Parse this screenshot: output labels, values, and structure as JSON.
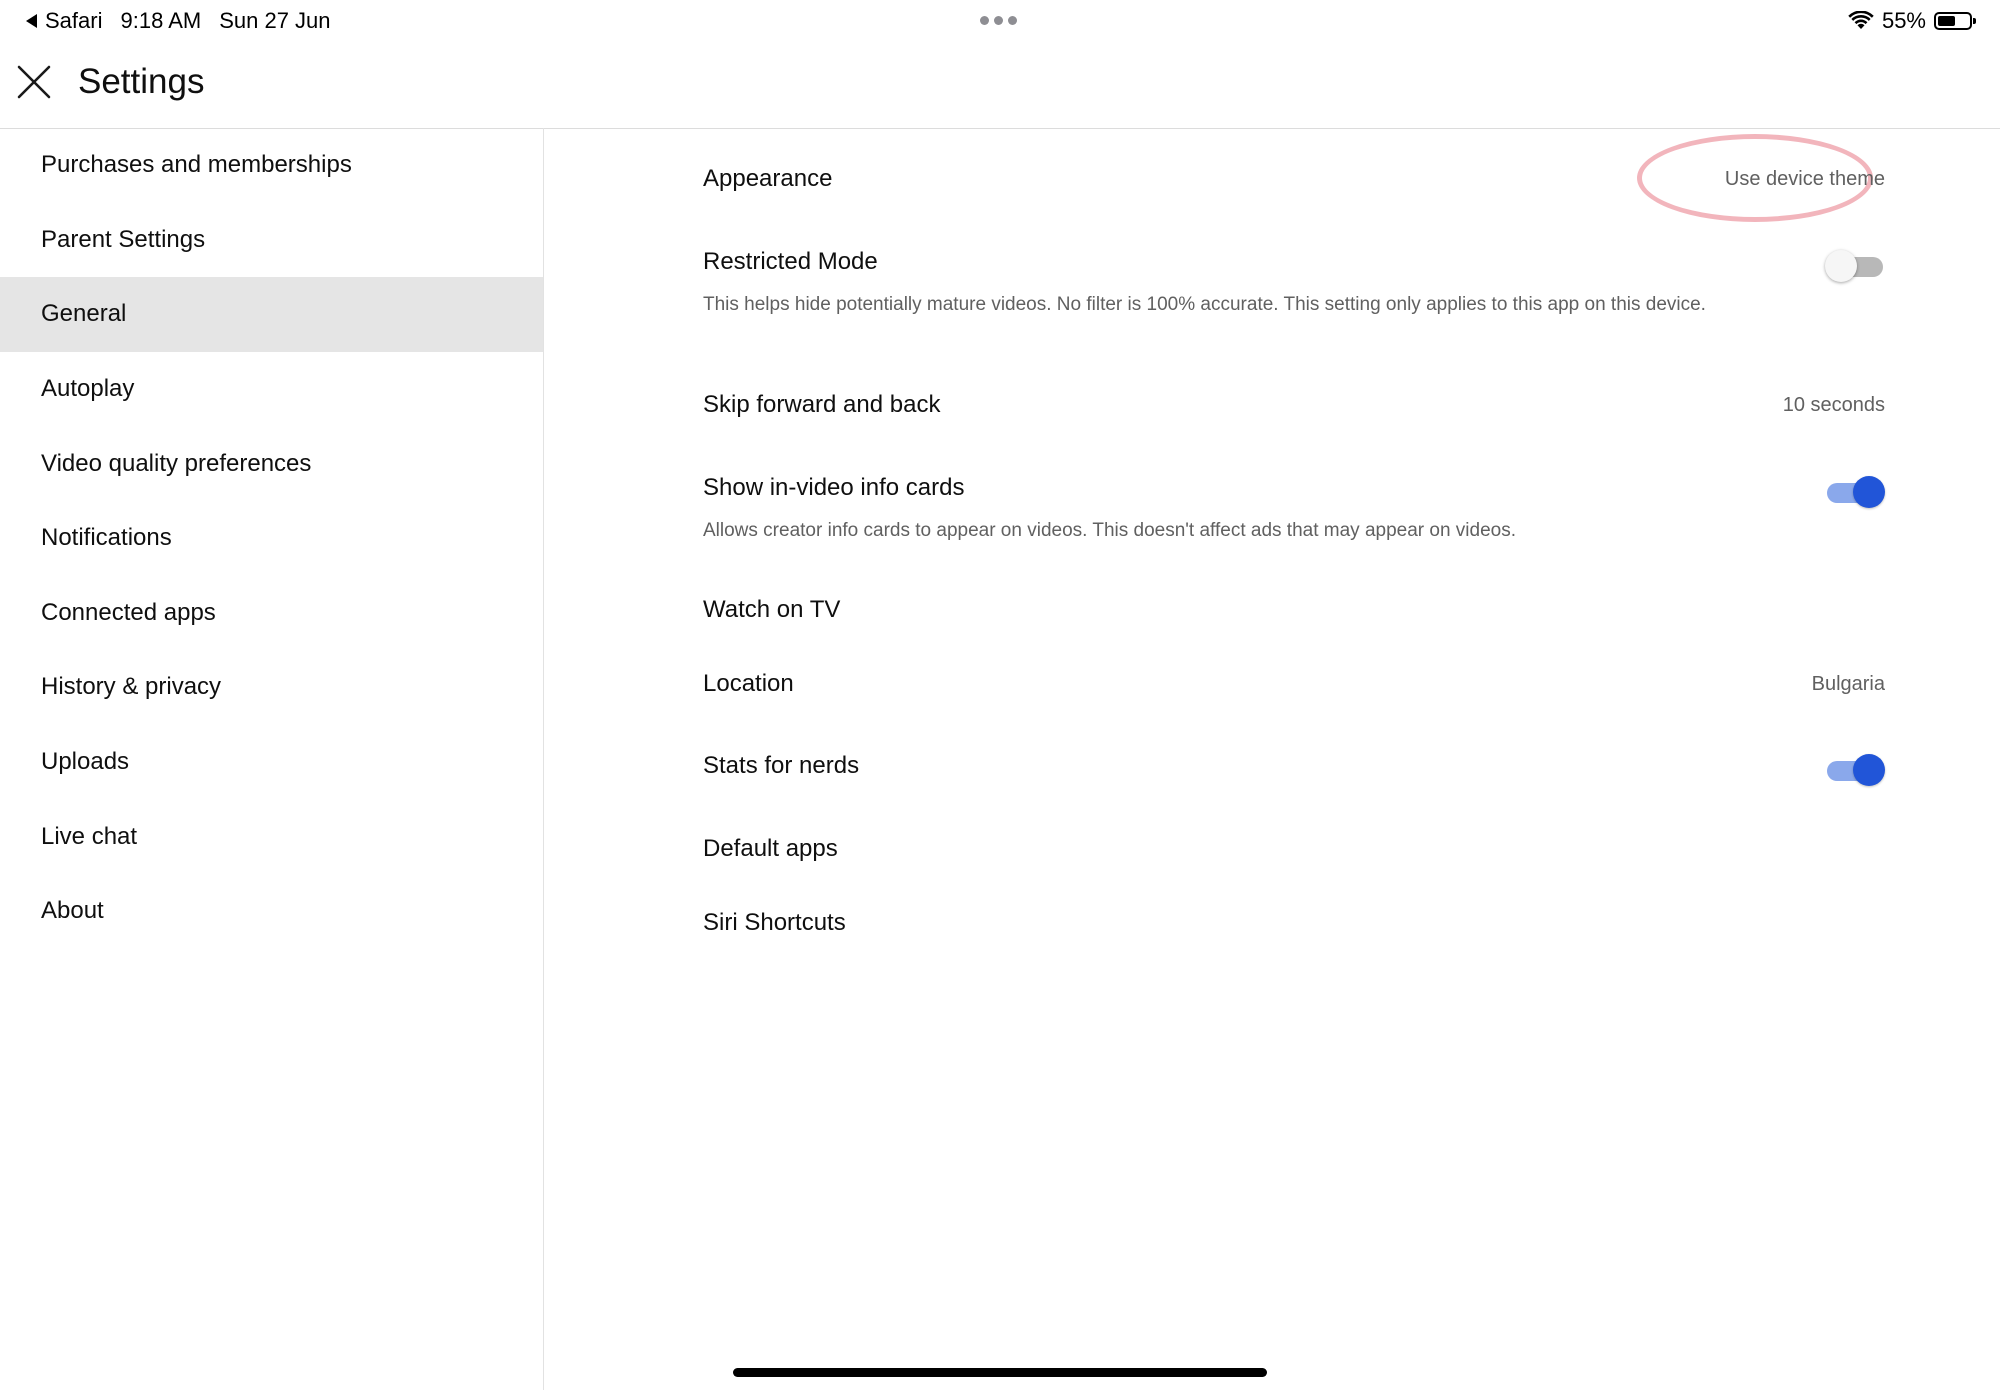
{
  "status_bar": {
    "app": "Safari",
    "time": "9:18 AM",
    "date": "Sun 27 Jun",
    "battery": "55%",
    "battery_level": 0.55
  },
  "header": {
    "title": "Settings",
    "close_icon": "close-icon"
  },
  "sidebar": {
    "items": [
      {
        "label": "Purchases and memberships",
        "active": false
      },
      {
        "label": "Parent Settings",
        "active": false
      },
      {
        "label": "General",
        "active": true
      },
      {
        "label": "Autoplay",
        "active": false
      },
      {
        "label": "Video quality preferences",
        "active": false
      },
      {
        "label": "Notifications",
        "active": false
      },
      {
        "label": "Connected apps",
        "active": false
      },
      {
        "label": "History & privacy",
        "active": false
      },
      {
        "label": "Uploads",
        "active": false
      },
      {
        "label": "Live chat",
        "active": false
      },
      {
        "label": "About",
        "active": false
      }
    ]
  },
  "settings": {
    "appearance": {
      "title": "Appearance",
      "value": "Use device theme"
    },
    "restricted_mode": {
      "title": "Restricted Mode",
      "description": "This helps hide potentially mature videos. No filter is 100% accurate. This setting only applies to this app on this device.",
      "enabled": false
    },
    "skip": {
      "title": "Skip forward and back",
      "value": "10 seconds"
    },
    "info_cards": {
      "title": "Show in-video info cards",
      "description": "Allows creator info cards to appear on videos. This doesn't affect ads that may appear on videos.",
      "enabled": true
    },
    "watch_on_tv": {
      "title": "Watch on TV"
    },
    "location": {
      "title": "Location",
      "value": "Bulgaria"
    },
    "stats_for_nerds": {
      "title": "Stats for nerds",
      "enabled": true
    },
    "default_apps": {
      "title": "Default apps"
    },
    "siri_shortcuts": {
      "title": "Siri Shortcuts"
    }
  },
  "colors": {
    "accent": "#2155d8",
    "active_item_bg": "#e5e5e5",
    "highlight_ring": "#f0a8b0"
  }
}
